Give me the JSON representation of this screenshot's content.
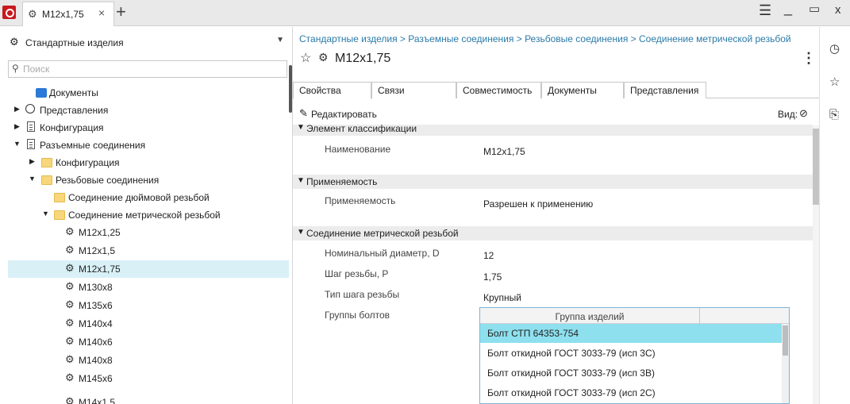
{
  "titlebar": {
    "tab_label": "M12x1,75",
    "tab_close": "×",
    "new_tab": "+",
    "menu": "☰",
    "minimize": "_",
    "maximize": "▭",
    "close": "x"
  },
  "left": {
    "library": "Стандартные изделия",
    "search_placeholder": "Поиск",
    "tree": [
      {
        "label": "Документы"
      },
      {
        "label": "Представления"
      },
      {
        "label": "Конфигурация"
      },
      {
        "label": "Разъемные соединения"
      },
      {
        "label": "Конфигурация"
      },
      {
        "label": "Резьбовые соединения"
      },
      {
        "label": "Соединение дюймовой резьбой"
      },
      {
        "label": "Соединение метрической резьбой"
      },
      {
        "label": "M12x1,25"
      },
      {
        "label": "M12x1,5"
      },
      {
        "label": "M12x1,75"
      },
      {
        "label": "M130x8"
      },
      {
        "label": "M135x6"
      },
      {
        "label": "M140x4"
      },
      {
        "label": "M140x6"
      },
      {
        "label": "M140x8"
      },
      {
        "label": "M145x6"
      },
      {
        "label": "M14x1,5"
      }
    ]
  },
  "right": {
    "breadcrumb": "Стандартные изделия > Разъемные соединения > Резьбовые соединения > Соединение метрической резьбой",
    "title": "M12x1,75",
    "tabs": [
      "Свойства",
      "Связи",
      "Совместимость",
      "Документы",
      "Представления"
    ],
    "edit_label": "Редактировать",
    "view_label": "Вид:",
    "sections": [
      {
        "title": "Элемент классификации"
      },
      {
        "title": "Применяемость"
      },
      {
        "title": "Соединение метрической резьбой"
      }
    ],
    "props": {
      "name_label": "Наименование",
      "name_value": "M12x1,75",
      "applic_label": "Применяемость",
      "applic_value": "Разрешен к применению",
      "diam_label": "Номинальный диаметр, D",
      "diam_value": "12",
      "pitch_label": "Шаг резьбы, P",
      "pitch_value": "1,75",
      "pitch_type_label": "Тип шага резьбы",
      "pitch_type_value": "Крупный",
      "bolt_groups_label": "Группы болтов"
    },
    "groups": {
      "header": "Группа изделий",
      "rows": [
        "Болт СТП 64353-754",
        "Болт откидной ГОСТ 3033-79 (исп 3С)",
        "Болт откидной ГОСТ 3033-79 (исп 3В)",
        "Болт откидной ГОСТ 3033-79 (исп 2С)"
      ]
    }
  },
  "colors": {
    "accent_link": "#2a7aa8",
    "selected_row": "#8ee0ee",
    "selected_tree": "#d9f0f7",
    "brand": "#c8191f"
  }
}
